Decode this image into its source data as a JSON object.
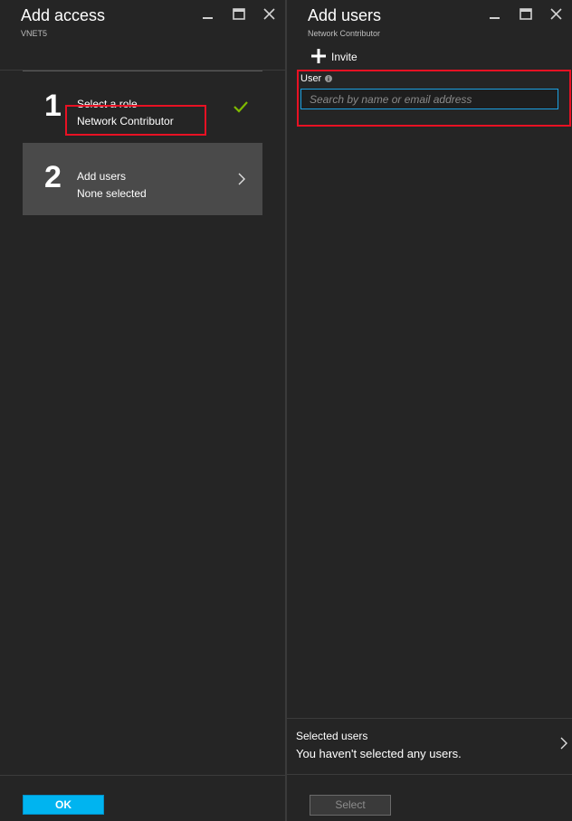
{
  "add_access": {
    "title": "Add access",
    "subtitle": "VNET5",
    "steps": [
      {
        "number": "1",
        "title": "Select a role",
        "value": "Network Contributor",
        "status": "complete"
      },
      {
        "number": "2",
        "title": "Add users",
        "value": "None selected",
        "status": "active"
      }
    ],
    "ok_label": "OK"
  },
  "add_users": {
    "title": "Add users",
    "subtitle": "Network Contributor",
    "invite_label": "Invite",
    "user_field": {
      "label": "User",
      "placeholder": "Search by name or email address",
      "value": ""
    },
    "selected_users": {
      "title": "Selected users",
      "value": "You haven't selected any users."
    },
    "select_label": "Select"
  },
  "colors": {
    "background": "#252525",
    "accent": "#00b4f0",
    "highlight_border": "#e81123",
    "check": "#7fba00"
  }
}
